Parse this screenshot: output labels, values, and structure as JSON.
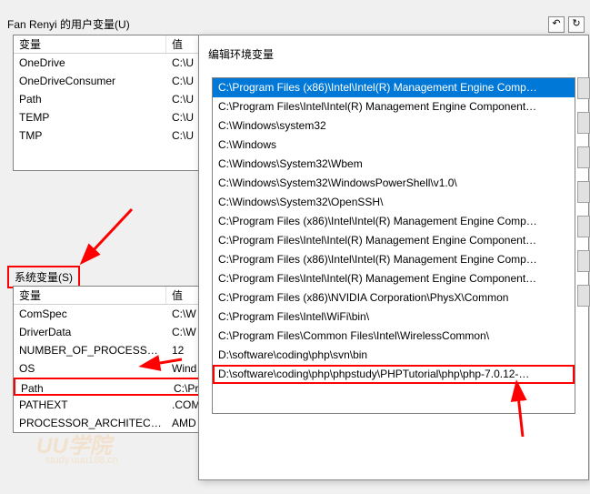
{
  "top_buttons": {
    "undo_tooltip": "↶",
    "refresh": "↻"
  },
  "user_vars": {
    "section_label": "Fan Renyi 的用户变量(U)",
    "header_var": "变量",
    "header_val": "值",
    "rows": [
      {
        "name": "OneDrive",
        "value": "C:\\U"
      },
      {
        "name": "OneDriveConsumer",
        "value": "C:\\U"
      },
      {
        "name": "Path",
        "value": "C:\\U"
      },
      {
        "name": "TEMP",
        "value": "C:\\U"
      },
      {
        "name": "TMP",
        "value": "C:\\U"
      }
    ]
  },
  "sys_vars": {
    "section_label": "系统变量(S)",
    "header_var": "变量",
    "header_val": "值",
    "rows": [
      {
        "name": "ComSpec",
        "value": "C:\\W"
      },
      {
        "name": "DriverData",
        "value": "C:\\W"
      },
      {
        "name": "NUMBER_OF_PROCESSORS",
        "value": "12"
      },
      {
        "name": "OS",
        "value": "Wind"
      },
      {
        "name": "Path",
        "value": "C:\\Pr",
        "highlighted": true
      },
      {
        "name": "PATHEXT",
        "value": ".COM"
      },
      {
        "name": "PROCESSOR_ARCHITECT…",
        "value": "AMD"
      }
    ]
  },
  "dialog": {
    "title": "编辑环境变量",
    "paths": [
      {
        "text": "C:\\Program Files (x86)\\Intel\\Intel(R) Management Engine Comp…",
        "selected": true
      },
      {
        "text": "C:\\Program Files\\Intel\\Intel(R) Management Engine Component…"
      },
      {
        "text": "C:\\Windows\\system32"
      },
      {
        "text": "C:\\Windows"
      },
      {
        "text": "C:\\Windows\\System32\\Wbem"
      },
      {
        "text": "C:\\Windows\\System32\\WindowsPowerShell\\v1.0\\"
      },
      {
        "text": "C:\\Windows\\System32\\OpenSSH\\"
      },
      {
        "text": "C:\\Program Files (x86)\\Intel\\Intel(R) Management Engine Comp…"
      },
      {
        "text": "C:\\Program Files\\Intel\\Intel(R) Management Engine Component…"
      },
      {
        "text": "C:\\Program Files (x86)\\Intel\\Intel(R) Management Engine Comp…"
      },
      {
        "text": "C:\\Program Files\\Intel\\Intel(R) Management Engine Component…"
      },
      {
        "text": "C:\\Program Files (x86)\\NVIDIA Corporation\\PhysX\\Common"
      },
      {
        "text": "C:\\Program Files\\Intel\\WiFi\\bin\\"
      },
      {
        "text": "C:\\Program Files\\Common Files\\Intel\\WirelessCommon\\"
      },
      {
        "text": "D:\\software\\coding\\php\\svn\\bin"
      },
      {
        "text": "D:\\software\\coding\\php\\phpstudy\\PHPTutorial\\php\\php-7.0.12-…",
        "boxed": true
      }
    ]
  },
  "watermark": {
    "main": "UU学院",
    "sub": "study.uuu188.cn"
  },
  "colors": {
    "accent_red": "#ff0000",
    "selection": "#0078d7"
  }
}
